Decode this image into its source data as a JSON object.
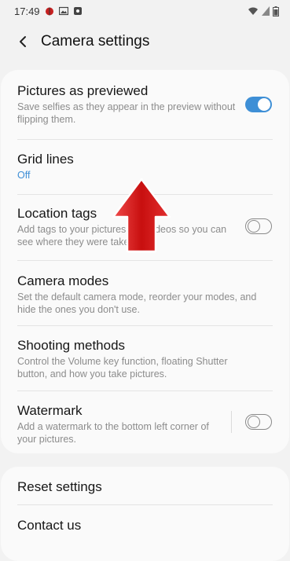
{
  "status_bar": {
    "time": "17:49"
  },
  "header": {
    "title": "Camera settings"
  },
  "settings": [
    {
      "title": "Pictures as previewed",
      "subtitle": "Save selfies as they appear in the preview without flipping them.",
      "toggle": true
    },
    {
      "title": "Grid lines",
      "subtitle": "Off"
    },
    {
      "title": "Location tags",
      "subtitle": "Add tags to your pictures and videos so you can see where they were taken.",
      "toggle": false
    },
    {
      "title": "Camera modes",
      "subtitle": "Set the default camera mode, reorder your modes, and hide the ones you don't use."
    },
    {
      "title": "Shooting methods",
      "subtitle": "Control the Volume key function, floating Shutter button, and how you take pictures."
    },
    {
      "title": "Watermark",
      "subtitle": "Add a watermark to the bottom left corner of your pictures.",
      "toggle": false
    }
  ],
  "bottom": [
    {
      "title": "Reset settings"
    },
    {
      "title": "Contact us"
    }
  ],
  "colors": {
    "accent": "#3e8fd6",
    "arrow": "#d81414"
  }
}
